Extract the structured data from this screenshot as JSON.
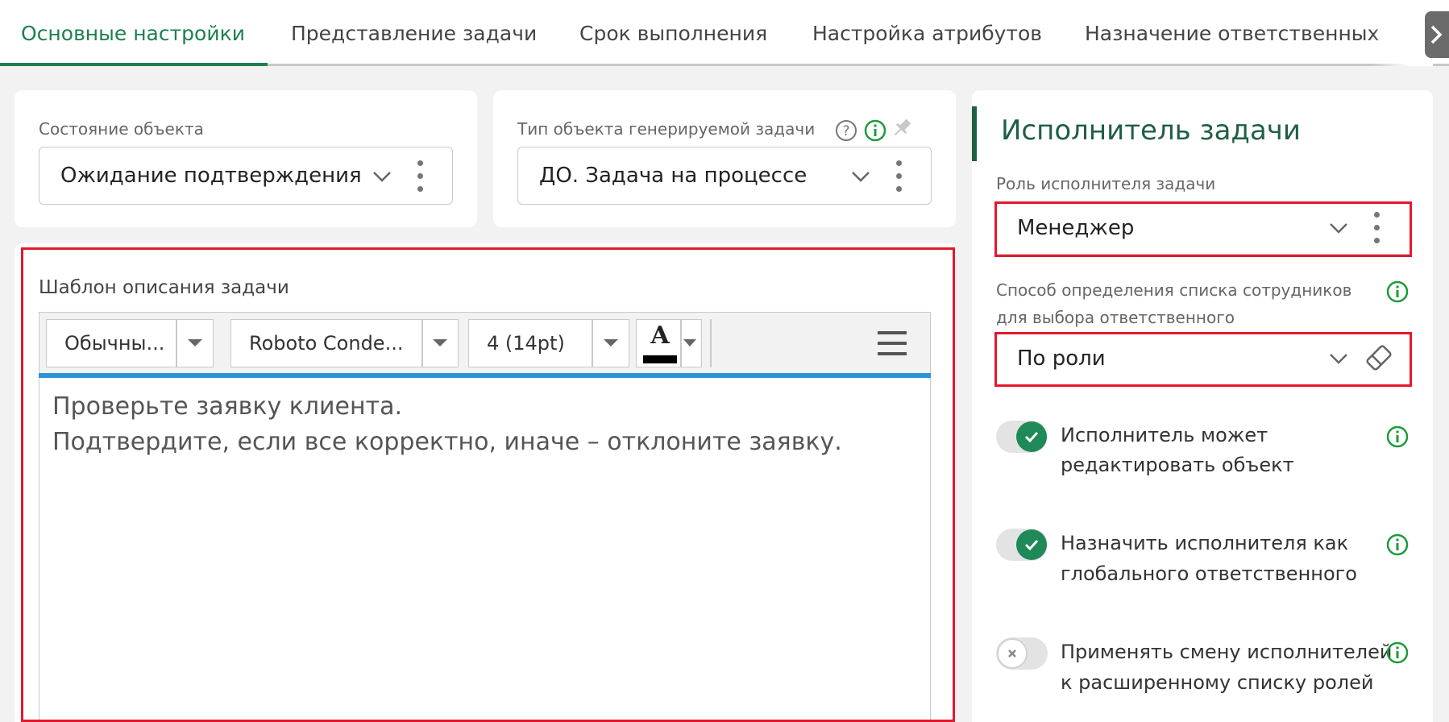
{
  "tabs": [
    {
      "label": "Основные настройки",
      "active": true
    },
    {
      "label": "Представление задачи",
      "active": false
    },
    {
      "label": "Срок выполнения",
      "active": false
    },
    {
      "label": "Настройка атрибутов",
      "active": false
    },
    {
      "label": "Назначение ответственных",
      "active": false
    }
  ],
  "object_state": {
    "label": "Состояние объекта",
    "value": "Ожидание подтверждения"
  },
  "object_type": {
    "label": "Тип объекта генерируемой задачи",
    "value": "ДО. Задача на процессе"
  },
  "editor": {
    "label": "Шаблон описания задачи",
    "toolbar": {
      "style": "Обычны...",
      "font": "Roboto Conde...",
      "size": "4 (14pt)",
      "color_glyph": "A"
    },
    "lines": [
      "Проверьте заявку клиента.",
      "Подтвердите, если все корректно, иначе – отклоните заявку."
    ]
  },
  "executor": {
    "title": "Исполнитель задачи",
    "role_label": "Роль исполнителя задачи",
    "role_value": "Менеджер",
    "method_label_1": "Способ определения списка сотрудников",
    "method_label_2": "для выбора ответственного",
    "method_value": "По роли",
    "toggles": [
      {
        "line1": "Исполнитель может",
        "line2": "редактировать объект",
        "on": true
      },
      {
        "line1": "Назначить исполнителя как",
        "line2": "глобального ответственного",
        "on": true
      },
      {
        "line1": "Применять смену исполнителей",
        "line2": "к расширенному списку ролей",
        "on": false
      }
    ]
  },
  "colors": {
    "accent": "#1e7f4f",
    "highlight": "#e3182d",
    "editor_focus": "#2e93d4"
  },
  "icons": [
    "chevron-down-icon",
    "kebab-menu-icon",
    "help-icon",
    "info-icon",
    "pin-icon",
    "eraser-icon",
    "check-icon",
    "close-icon",
    "hamburger-menu-icon",
    "chevron-right-icon"
  ]
}
